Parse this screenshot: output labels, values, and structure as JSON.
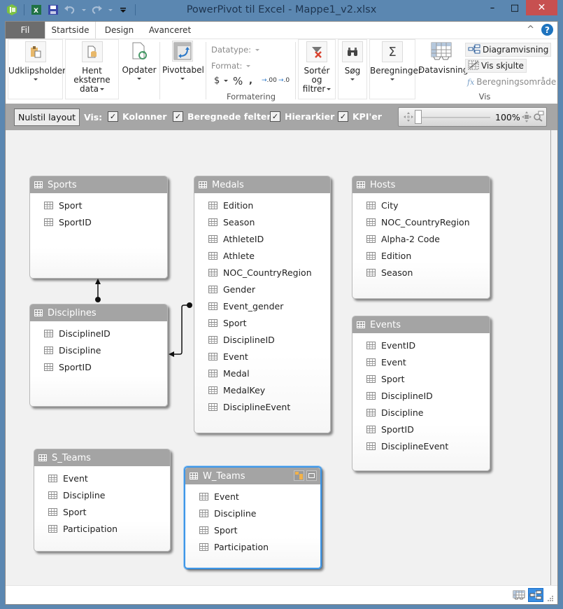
{
  "window": {
    "title": "PowerPivot til Excel - Mappe1_v2.xlsx",
    "controls": {
      "minimize": "–",
      "maximize": "□",
      "close": "✕"
    }
  },
  "quick_access": {
    "icons": [
      "powerpivot-icon",
      "excel-icon",
      "save-icon",
      "undo-icon",
      "redo-icon",
      "customize-qat-icon"
    ]
  },
  "ribbon": {
    "tabs": [
      {
        "label": "Fil",
        "active": false
      },
      {
        "label": "Startside",
        "active": true
      },
      {
        "label": "Design",
        "active": false
      },
      {
        "label": "Avanceret",
        "active": false
      }
    ],
    "collapse_glyph": "^",
    "help_glyph": "?",
    "buttons": {
      "clipboard": "Udklipsholder",
      "get_external_data_line1": "Hent eksterne",
      "get_external_data_line2": "data",
      "refresh": "Opdater",
      "pivottable": "Pivottabel",
      "sort_filter_line1": "Sortér og",
      "sort_filter_line2": "filtrer",
      "find": "Søg",
      "calculations": "Beregninger",
      "data_view": "Datavisning",
      "diagram_view": "Diagramvisning",
      "show_hidden": "Vis skjulte",
      "calculation_area": "Beregningsområde"
    },
    "formatting": {
      "datatype_label": "Datatype:",
      "format_label": "Format:",
      "currency": "$",
      "percent": "%",
      "comma": "ʔ",
      "increase_decimal": ".00",
      "decrease_decimal": ".0",
      "group_name": "Formatering"
    },
    "groups": {
      "vis": "Vis"
    }
  },
  "diagram_toolbar": {
    "reset_layout": "Nulstil layout",
    "show_label": "Vis:",
    "checkboxes": [
      {
        "label": "Kolonner",
        "checked": true
      },
      {
        "label": "Beregnede felter",
        "checked": true
      },
      {
        "label": "Hierarkier",
        "checked": true
      },
      {
        "label": "KPI'er",
        "checked": true
      }
    ],
    "zoom": {
      "value_text": "100%",
      "level_percent": 100
    }
  },
  "tables": [
    {
      "name": "Sports",
      "columns": [
        "Sport",
        "SportID"
      ]
    },
    {
      "name": "Medals",
      "columns": [
        "Edition",
        "Season",
        "AthleteID",
        "Athlete",
        "NOC_CountryRegion",
        "Gender",
        "Event_gender",
        "Sport",
        "DisciplineID",
        "Event",
        "Medal",
        "MedalKey",
        "DisciplineEvent"
      ]
    },
    {
      "name": "Hosts",
      "columns": [
        "City",
        "NOC_CountryRegion",
        "Alpha-2 Code",
        "Edition",
        "Season"
      ]
    },
    {
      "name": "Disciplines",
      "columns": [
        "DisciplineID",
        "Discipline",
        "SportID"
      ]
    },
    {
      "name": "Events",
      "columns": [
        "EventID",
        "Event",
        "Sport",
        "DisciplineID",
        "Discipline",
        "SportID",
        "DisciplineEvent"
      ]
    },
    {
      "name": "S_Teams",
      "columns": [
        "Event",
        "Discipline",
        "Sport",
        "Participation"
      ]
    },
    {
      "name": "W_Teams",
      "columns": [
        "Event",
        "Discipline",
        "Sport",
        "Participation"
      ],
      "selected": true
    }
  ],
  "relationships": [
    {
      "from": "Disciplines",
      "to": "Sports"
    },
    {
      "from": "Medals",
      "to": "Disciplines"
    }
  ],
  "statusbar": {
    "views": [
      {
        "name": "data-view",
        "active": false
      },
      {
        "name": "diagram-view",
        "active": true
      }
    ]
  },
  "colors": {
    "window_frame": "#5b87b1",
    "file_tab": "#6d6d6d",
    "table_header": "#a4a4a4",
    "selection": "#3e97e8",
    "close_button": "#c75050",
    "canvas": "#f1f1f1"
  }
}
